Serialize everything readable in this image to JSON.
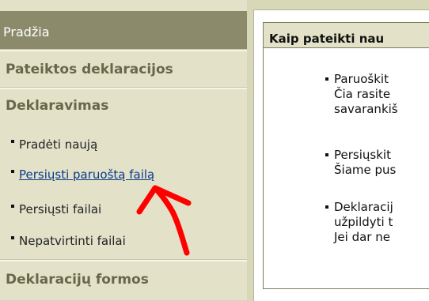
{
  "sidebar": {
    "header": "Pradžia",
    "sections": [
      "Pateiktos deklaracijos",
      "Deklaravimas",
      "Deklaracijų formos"
    ],
    "items": [
      {
        "label": "Pradėti naują"
      },
      {
        "label": "Persiųsti paruoštą failą"
      },
      {
        "label": "Persiųsti failai"
      },
      {
        "label": "Nepatvirtinti failai"
      }
    ]
  },
  "main": {
    "box_title": "Kaip pateikti nau",
    "bullets": [
      {
        "lines": [
          "Paruoškit",
          "Čia rasite",
          "savarankiš"
        ]
      },
      {
        "lines": [
          "Persiųskit",
          "Šiame pus"
        ]
      },
      {
        "lines": [
          "Deklaracij",
          "užpildyti t",
          "Jei dar ne"
        ]
      }
    ]
  },
  "colors": {
    "sidebar_header": "#8b8b6c",
    "sidebar_bg": "#e3e2c8",
    "section_text": "#67674a",
    "link": "#0a3b8c",
    "annotation_arrow": "#ff0000"
  }
}
